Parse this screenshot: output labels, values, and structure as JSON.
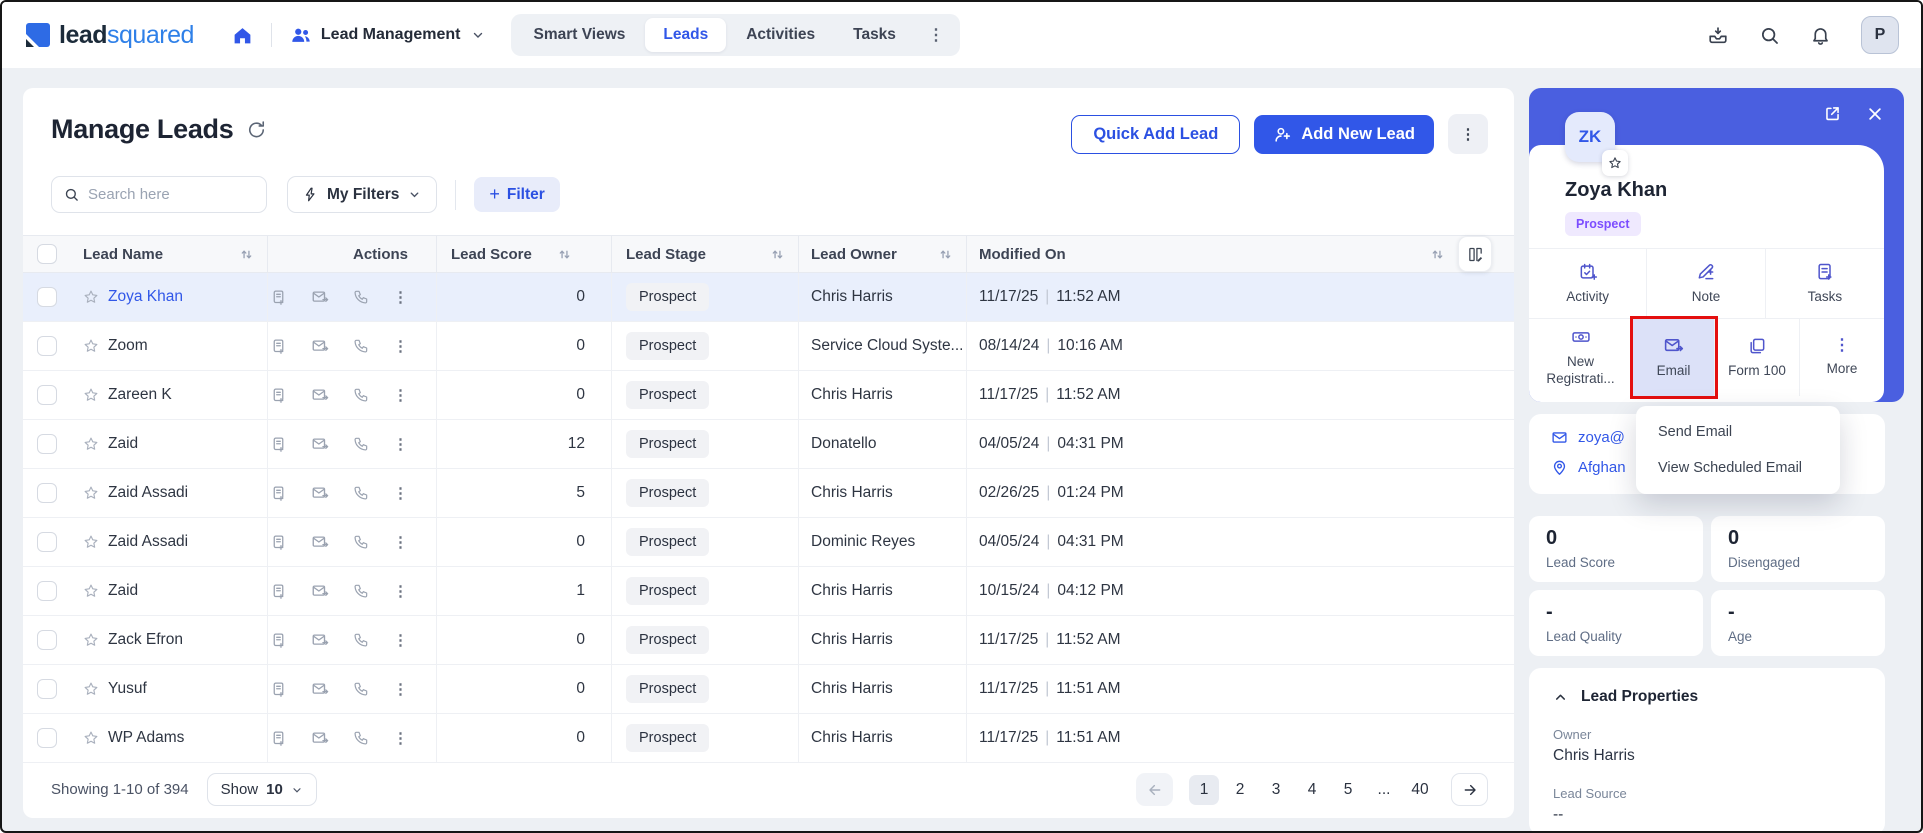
{
  "colors": {
    "primary": "#3157e8",
    "panel_blue": "#4a5fe0",
    "highlight_red": "#e40f0f",
    "stage_purple": "#7c4dff"
  },
  "navbar": {
    "logo": {
      "dark": "lead",
      "blue": "squared"
    },
    "workspace_label": "Lead Management",
    "tabs": [
      {
        "label": "Smart Views",
        "active": false
      },
      {
        "label": "Leads",
        "active": true
      },
      {
        "label": "Activities",
        "active": false
      },
      {
        "label": "Tasks",
        "active": false
      }
    ],
    "avatar_initial": "P"
  },
  "page": {
    "title": "Manage Leads",
    "quick_add_label": "Quick Add Lead",
    "add_new_label": "Add New Lead",
    "search_placeholder": "Search here",
    "my_filters_label": "My Filters",
    "filter_label": "Filter"
  },
  "table": {
    "columns": [
      "Lead Name",
      "Actions",
      "Lead Score",
      "Lead Stage",
      "Lead Owner",
      "Modified On"
    ],
    "rows": [
      {
        "name": "Zoya Khan",
        "score": "0",
        "stage": "Prospect",
        "owner": "Chris Harris",
        "date": "11/17/25",
        "time": "11:52 AM",
        "selected": true
      },
      {
        "name": "Zoom",
        "score": "0",
        "stage": "Prospect",
        "owner": "Service Cloud Syste...",
        "date": "08/14/24",
        "time": "10:16 AM",
        "selected": false
      },
      {
        "name": "Zareen K",
        "score": "0",
        "stage": "Prospect",
        "owner": "Chris Harris",
        "date": "11/17/25",
        "time": "11:52 AM",
        "selected": false
      },
      {
        "name": "Zaid",
        "score": "12",
        "stage": "Prospect",
        "owner": "Donatello",
        "date": "04/05/24",
        "time": "04:31 PM",
        "selected": false
      },
      {
        "name": "Zaid Assadi",
        "score": "5",
        "stage": "Prospect",
        "owner": "Chris Harris",
        "date": "02/26/25",
        "time": "01:24 PM",
        "selected": false
      },
      {
        "name": "Zaid Assadi",
        "score": "0",
        "stage": "Prospect",
        "owner": "Dominic Reyes",
        "date": "04/05/24",
        "time": "04:31 PM",
        "selected": false
      },
      {
        "name": "Zaid",
        "score": "1",
        "stage": "Prospect",
        "owner": "Chris Harris",
        "date": "10/15/24",
        "time": "04:12 PM",
        "selected": false
      },
      {
        "name": "Zack Efron",
        "score": "0",
        "stage": "Prospect",
        "owner": "Chris Harris",
        "date": "11/17/25",
        "time": "11:52 AM",
        "selected": false
      },
      {
        "name": "Yusuf",
        "score": "0",
        "stage": "Prospect",
        "owner": "Chris Harris",
        "date": "11/17/25",
        "time": "11:51 AM",
        "selected": false
      },
      {
        "name": "WP Adams",
        "score": "0",
        "stage": "Prospect",
        "owner": "Chris Harris",
        "date": "11/17/25",
        "time": "11:51 AM",
        "selected": false
      }
    ],
    "footer": {
      "showing": "Showing 1-10 of 394",
      "show_label": "Show",
      "show_value": "10",
      "pages": [
        {
          "n": "1",
          "active": true
        },
        {
          "n": "2",
          "active": false
        },
        {
          "n": "3",
          "active": false
        },
        {
          "n": "4",
          "active": false
        },
        {
          "n": "5",
          "active": false
        },
        {
          "n": "...",
          "active": false
        },
        {
          "n": "40",
          "active": false
        }
      ]
    }
  },
  "panel": {
    "initials": "ZK",
    "name": "Zoya Khan",
    "stage": "Prospect",
    "tiles_row1": [
      {
        "label": "Activity",
        "icon": "activity-calendar-icon"
      },
      {
        "label": "Note",
        "icon": "note-pen-icon"
      },
      {
        "label": "Tasks",
        "icon": "tasks-doc-icon"
      }
    ],
    "tiles_row2": [
      {
        "label": "New Registrati...",
        "icon": "banknote-icon"
      },
      {
        "label": "Email",
        "icon": "email-send-icon",
        "highlighted": true
      },
      {
        "label": "Form 100",
        "icon": "form-copy-icon"
      },
      {
        "label": "More",
        "icon": "more-dots-icon"
      }
    ],
    "email_menu": [
      "Send Email",
      "View Scheduled Email"
    ],
    "contact": {
      "email": "zoya@",
      "location": "Afghan"
    },
    "stats": [
      {
        "value": "0",
        "label": "Lead Score"
      },
      {
        "value": "0",
        "label": "Disengaged"
      },
      {
        "value": "-",
        "label": "Lead Quality"
      },
      {
        "value": "-",
        "label": "Age"
      }
    ],
    "properties": {
      "title": "Lead Properties",
      "fields": [
        {
          "label": "Owner",
          "value": "Chris Harris"
        },
        {
          "label": "Lead Source",
          "value": "--"
        }
      ]
    }
  }
}
